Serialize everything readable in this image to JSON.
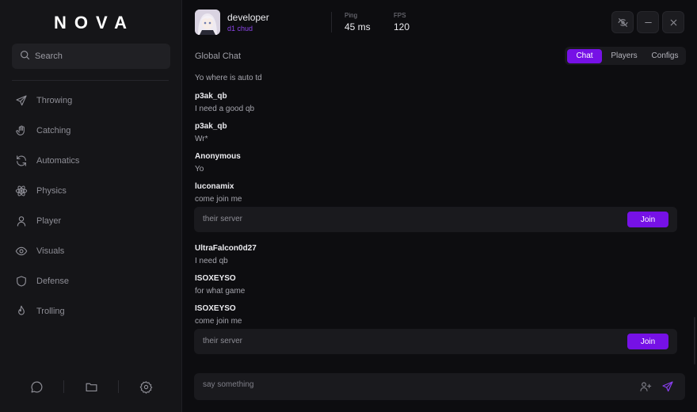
{
  "app": {
    "logo": "NOVA"
  },
  "sidebar": {
    "search_placeholder": "Search",
    "items": [
      {
        "label": "Throwing",
        "icon": "send-icon"
      },
      {
        "label": "Catching",
        "icon": "hand-icon"
      },
      {
        "label": "Automatics",
        "icon": "refresh-icon"
      },
      {
        "label": "Physics",
        "icon": "atom-icon"
      },
      {
        "label": "Player",
        "icon": "user-icon"
      },
      {
        "label": "Visuals",
        "icon": "eye-icon"
      },
      {
        "label": "Defense",
        "icon": "shield-icon"
      },
      {
        "label": "Trolling",
        "icon": "flame-icon"
      }
    ],
    "bottom_icons": [
      "chat-bubble-icon",
      "folder-icon",
      "gear-icon"
    ]
  },
  "header": {
    "user": {
      "name": "developer",
      "subtitle": "d1 chud"
    },
    "stats": [
      {
        "label": "Ping",
        "value": "45 ms"
      },
      {
        "label": "FPS",
        "value": "120"
      }
    ],
    "window_buttons": [
      "eye-off-icon",
      "minimize-icon",
      "close-icon"
    ]
  },
  "chat": {
    "title": "Global Chat",
    "tabs": [
      {
        "label": "Chat",
        "active": true
      },
      {
        "label": "Players",
        "active": false
      },
      {
        "label": "Configs",
        "active": false
      }
    ],
    "first_line": "Yo where is auto td",
    "messages": [
      {
        "author": "p3ak_qb",
        "text": "I need a good qb"
      },
      {
        "author": "p3ak_qb",
        "text": "Wr*"
      },
      {
        "author": "Anonymous",
        "text": "Yo"
      },
      {
        "author": "luconamix",
        "text": "come join me"
      },
      {
        "author": "UltraFalcon0d27",
        "text": "I need qb"
      },
      {
        "author": "ISOXEYSO",
        "text": "for what game"
      },
      {
        "author": "ISOXEYSO",
        "text": "come join me"
      }
    ],
    "invites": [
      {
        "label": "their server",
        "button": "Join"
      },
      {
        "label": "their server",
        "button": "Join"
      }
    ],
    "composer_placeholder": "say something"
  },
  "colors": {
    "accent": "#7611e6",
    "username_sub": "#8b45e8",
    "background": "#0d0d10",
    "sidebar": "#151518"
  }
}
